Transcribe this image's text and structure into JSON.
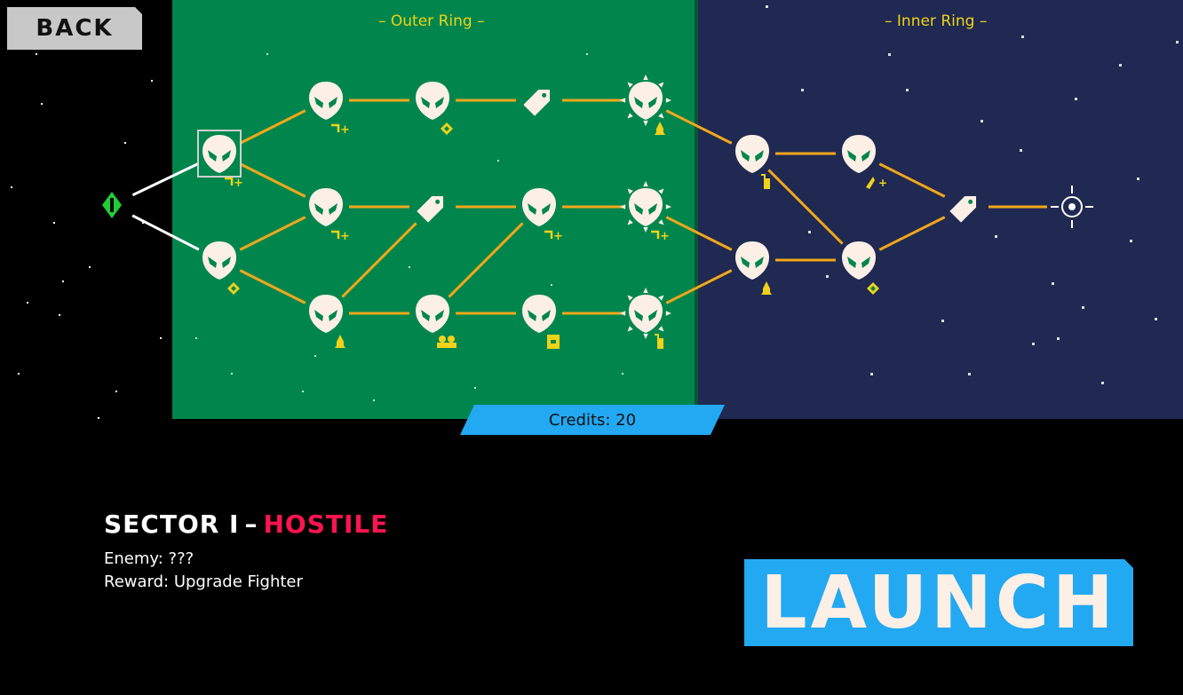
{
  "buttons": {
    "back_label": "BACK",
    "launch_label": "LAUNCH"
  },
  "regions": {
    "outer_label": "– Outer Ring –",
    "inner_label": "– Inner Ring –"
  },
  "credits_label": "Credits: 20",
  "sector": {
    "name": "SECTOR I",
    "separator": "–",
    "status": "HOSTILE"
  },
  "info": {
    "enemy": "Enemy: ???",
    "reward": "Reward: Upgrade Fighter"
  },
  "colors": {
    "outer_ring": "#00864d",
    "inner_ring": "#1f2951",
    "path": "#f2a71b",
    "start_path": "#ffffff",
    "reward_icon": "#f0d21a",
    "hostile": "#ff1450",
    "accent_button": "#23a8f2",
    "start_node": "#22cc33"
  },
  "map": {
    "nodes": [
      {
        "id": "start",
        "type": "start"
      },
      {
        "id": "a1",
        "type": "alien",
        "reward": "speed-upgrade-icon",
        "selected": true
      },
      {
        "id": "a2",
        "type": "alien",
        "reward": "diamond-icon"
      },
      {
        "id": "b1",
        "type": "alien",
        "reward": "swap-upgrade-icon"
      },
      {
        "id": "b2",
        "type": "alien",
        "reward": "speed-upgrade-icon"
      },
      {
        "id": "b3",
        "type": "alien",
        "reward": "rocket-icon"
      },
      {
        "id": "c1",
        "type": "alien",
        "reward": "diamond-icon"
      },
      {
        "id": "c2",
        "type": "shop"
      },
      {
        "id": "c3",
        "type": "alien",
        "reward": "crew-icon"
      },
      {
        "id": "d1",
        "type": "shop"
      },
      {
        "id": "d2",
        "type": "alien",
        "reward": "speed-upgrade-icon"
      },
      {
        "id": "d3",
        "type": "alien",
        "reward": "card-icon"
      },
      {
        "id": "e1",
        "type": "boss",
        "reward": "rocket-icon"
      },
      {
        "id": "e2",
        "type": "boss",
        "reward": "swap-upgrade-icon"
      },
      {
        "id": "e3",
        "type": "boss",
        "reward": "extinguisher-icon"
      },
      {
        "id": "f1",
        "type": "alien",
        "reward": "extinguisher-icon"
      },
      {
        "id": "f2",
        "type": "alien",
        "reward": "rocket-icon"
      },
      {
        "id": "g1",
        "type": "alien",
        "reward": "weapon-upgrade-icon"
      },
      {
        "id": "g2",
        "type": "alien",
        "reward": "diamond-icon"
      },
      {
        "id": "h1",
        "type": "shop"
      },
      {
        "id": "goal",
        "type": "target"
      }
    ],
    "edges": [
      [
        "start",
        "a1"
      ],
      [
        "start",
        "a2"
      ],
      [
        "a1",
        "b1"
      ],
      [
        "a1",
        "b2"
      ],
      [
        "a2",
        "b2"
      ],
      [
        "a2",
        "b3"
      ],
      [
        "b1",
        "c1"
      ],
      [
        "b2",
        "c2"
      ],
      [
        "b3",
        "c3"
      ],
      [
        "b3",
        "c2"
      ],
      [
        "c1",
        "d1"
      ],
      [
        "c2",
        "d2"
      ],
      [
        "c3",
        "d2"
      ],
      [
        "c3",
        "d3"
      ],
      [
        "d1",
        "e1"
      ],
      [
        "d2",
        "e2"
      ],
      [
        "d3",
        "e3"
      ],
      [
        "e1",
        "f1"
      ],
      [
        "e2",
        "f2"
      ],
      [
        "e3",
        "f2"
      ],
      [
        "f1",
        "g1"
      ],
      [
        "f1",
        "g2"
      ],
      [
        "f2",
        "g2"
      ],
      [
        "g1",
        "h1"
      ],
      [
        "g2",
        "h1"
      ],
      [
        "h1",
        "goal"
      ]
    ]
  }
}
